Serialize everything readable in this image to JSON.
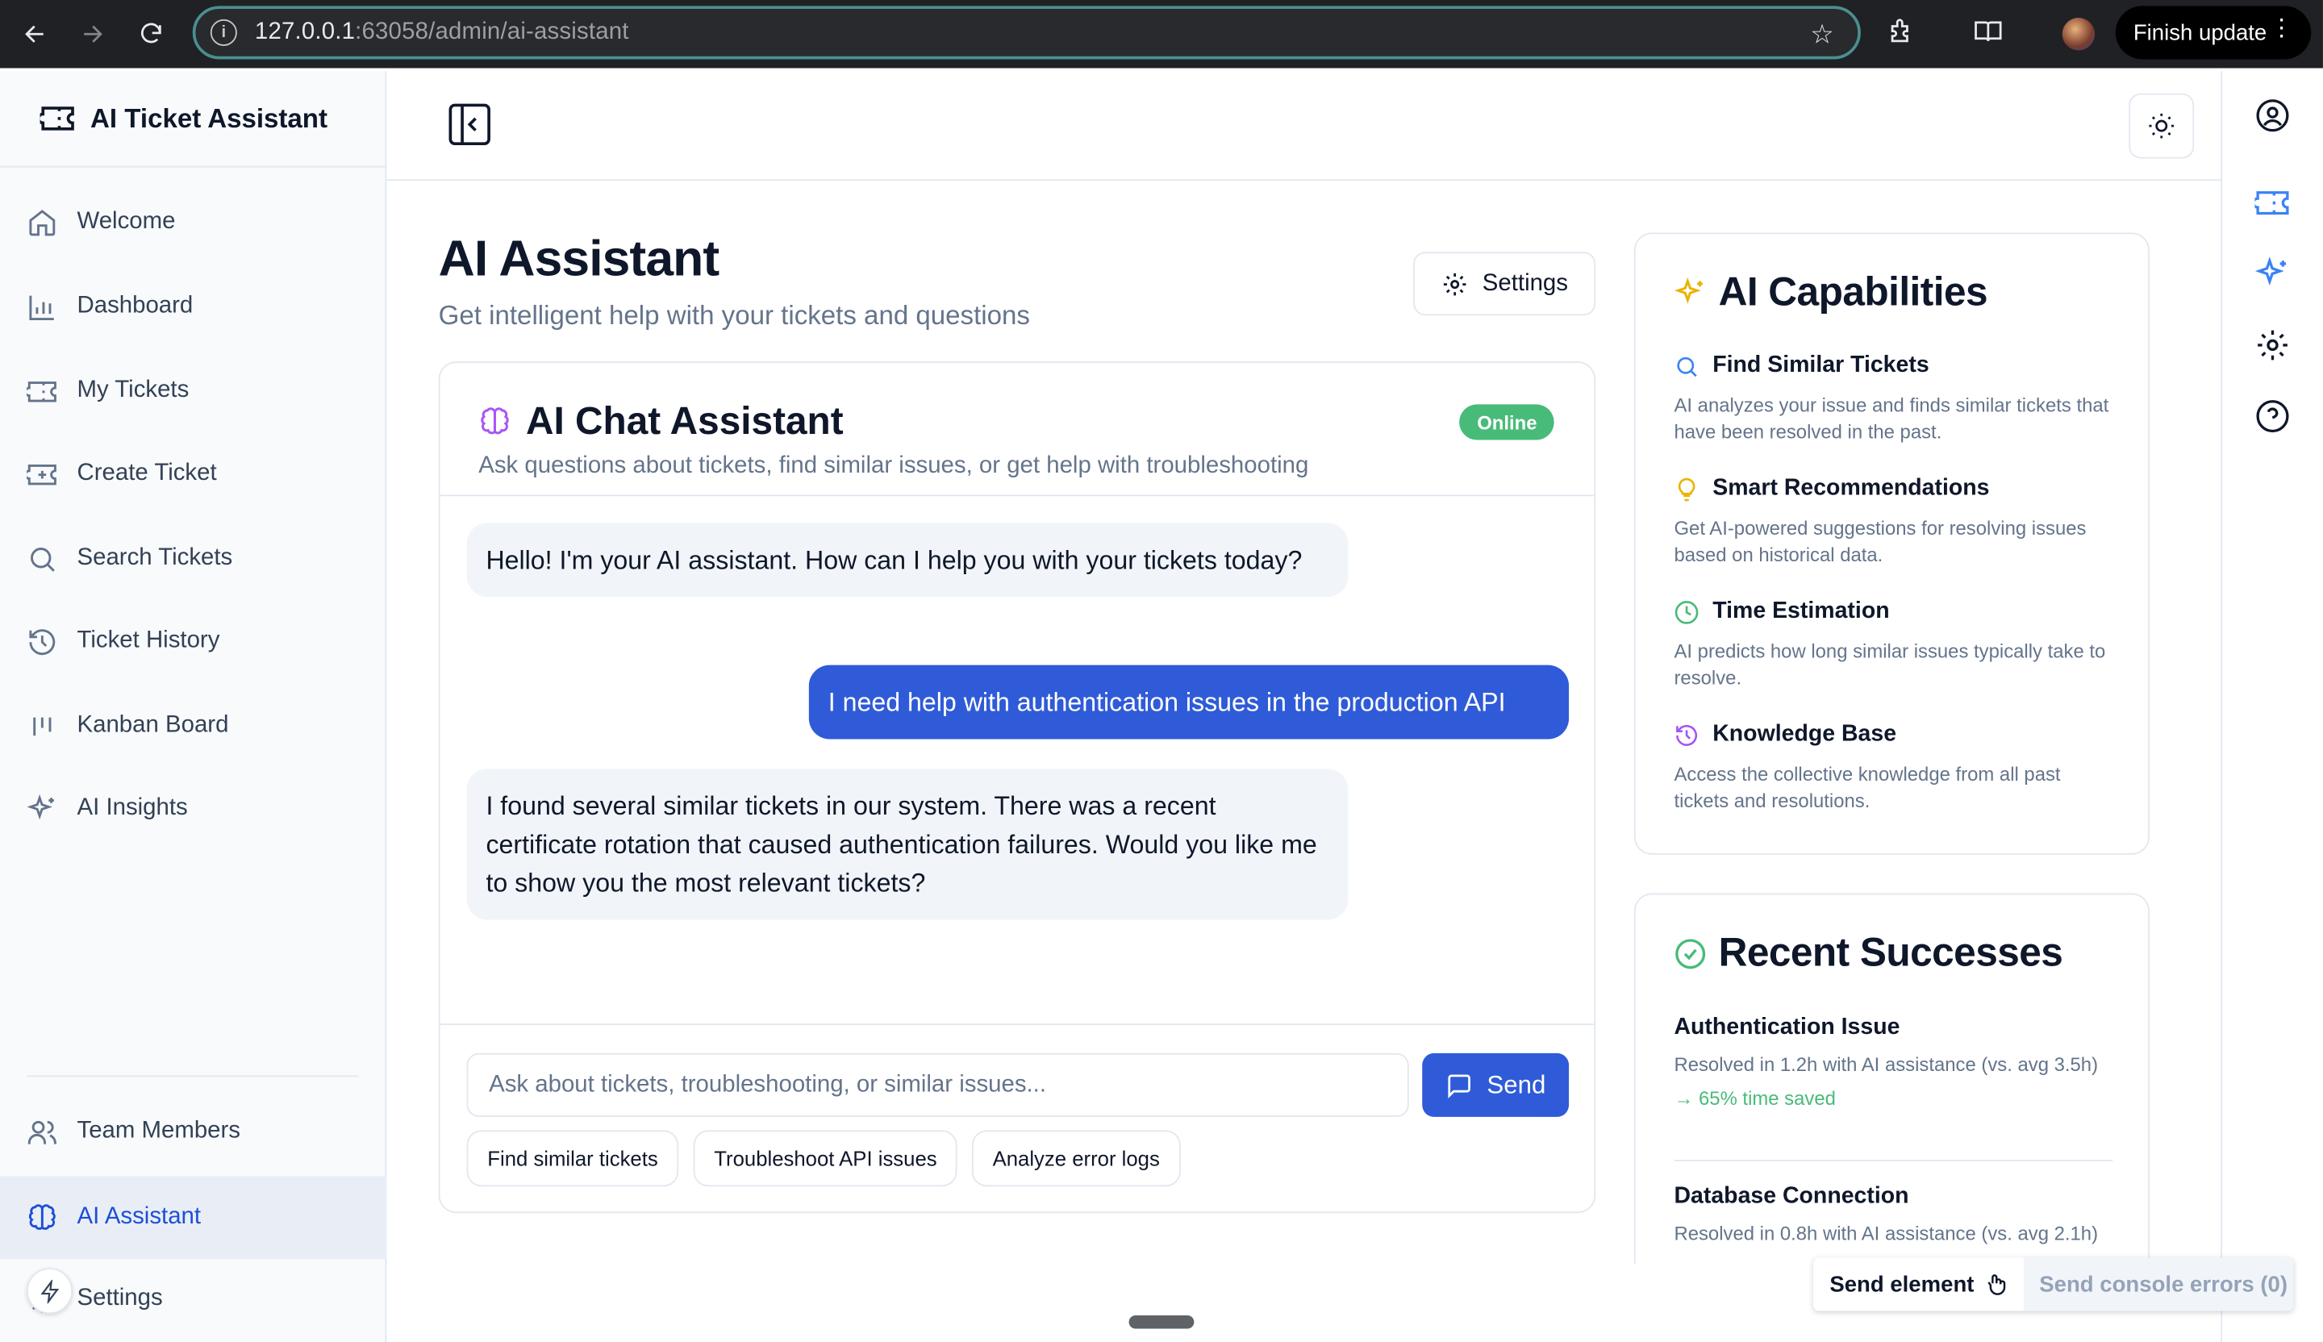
{
  "browser": {
    "url_host": "127.0.0.1",
    "url_rest": ":63058/admin/ai-assistant",
    "finish_update": "Finish update"
  },
  "sidebar": {
    "brand": "AI Ticket Assistant",
    "items": [
      {
        "label": "Welcome",
        "icon": "home-icon"
      },
      {
        "label": "Dashboard",
        "icon": "bar-chart-icon"
      },
      {
        "label": "My Tickets",
        "icon": "ticket-icon"
      },
      {
        "label": "Create Ticket",
        "icon": "ticket-plus-icon"
      },
      {
        "label": "Search Tickets",
        "icon": "search-icon"
      },
      {
        "label": "Ticket History",
        "icon": "history-icon"
      },
      {
        "label": "Kanban Board",
        "icon": "kanban-icon"
      },
      {
        "label": "AI Insights",
        "icon": "sparkles-icon"
      },
      {
        "label": "Team Members",
        "icon": "users-icon"
      },
      {
        "label": "AI Assistant",
        "icon": "brain-icon",
        "active": true
      },
      {
        "label": "Settings",
        "icon": "gear-icon"
      }
    ]
  },
  "main": {
    "title": "AI Assistant",
    "subtitle": "Get intelligent help with your tickets and questions",
    "settings_label": "Settings"
  },
  "chat": {
    "title": "AI Chat Assistant",
    "description": "Ask questions about tickets, find similar issues, or get help with troubleshooting",
    "status": "Online",
    "messages": [
      {
        "role": "assistant",
        "text": "Hello! I'm your AI assistant. How can I help you with your tickets today?"
      },
      {
        "role": "user",
        "text": "I need help with authentication issues in the production API"
      },
      {
        "role": "assistant",
        "text": "I found several similar tickets in our system. There was a recent certificate rotation that caused authentication failures. Would you like me to show you the most relevant tickets?"
      }
    ],
    "input_placeholder": "Ask about tickets, troubleshooting, or similar issues...",
    "input_value": "",
    "send_label": "Send",
    "chips": [
      "Find similar tickets",
      "Troubleshoot API issues",
      "Analyze error logs"
    ]
  },
  "capabilities": {
    "title": "AI Capabilities",
    "items": [
      {
        "title": "Find Similar Tickets",
        "desc": "AI analyzes your issue and finds similar tickets that have been resolved in the past.",
        "icon": "search-icon",
        "color": "#3b82f6"
      },
      {
        "title": "Smart Recommendations",
        "desc": "Get AI-powered suggestions for resolving issues based on historical data.",
        "icon": "lightbulb-icon",
        "color": "#eab308"
      },
      {
        "title": "Time Estimation",
        "desc": "AI predicts how long similar issues typically take to resolve.",
        "icon": "clock-icon",
        "color": "#48bb78"
      },
      {
        "title": "Knowledge Base",
        "desc": "Access the collective knowledge from all past tickets and resolutions.",
        "icon": "history-icon",
        "color": "#a855f7"
      }
    ]
  },
  "successes": {
    "title": "Recent Successes",
    "items": [
      {
        "title": "Authentication Issue",
        "desc": "Resolved in 1.2h with AI assistance (vs. avg 3.5h)",
        "saved": "65% time saved"
      },
      {
        "title": "Database Connection",
        "desc": "Resolved in 0.8h with AI assistance (vs. avg 2.1h)"
      }
    ]
  },
  "devtools": {
    "send_element": "Send element",
    "send_console": "Send console errors (0)"
  },
  "colors": {
    "accent": "#2f5bd8",
    "online": "#48bb78",
    "sidebar_active_bg": "#e9eef6"
  }
}
